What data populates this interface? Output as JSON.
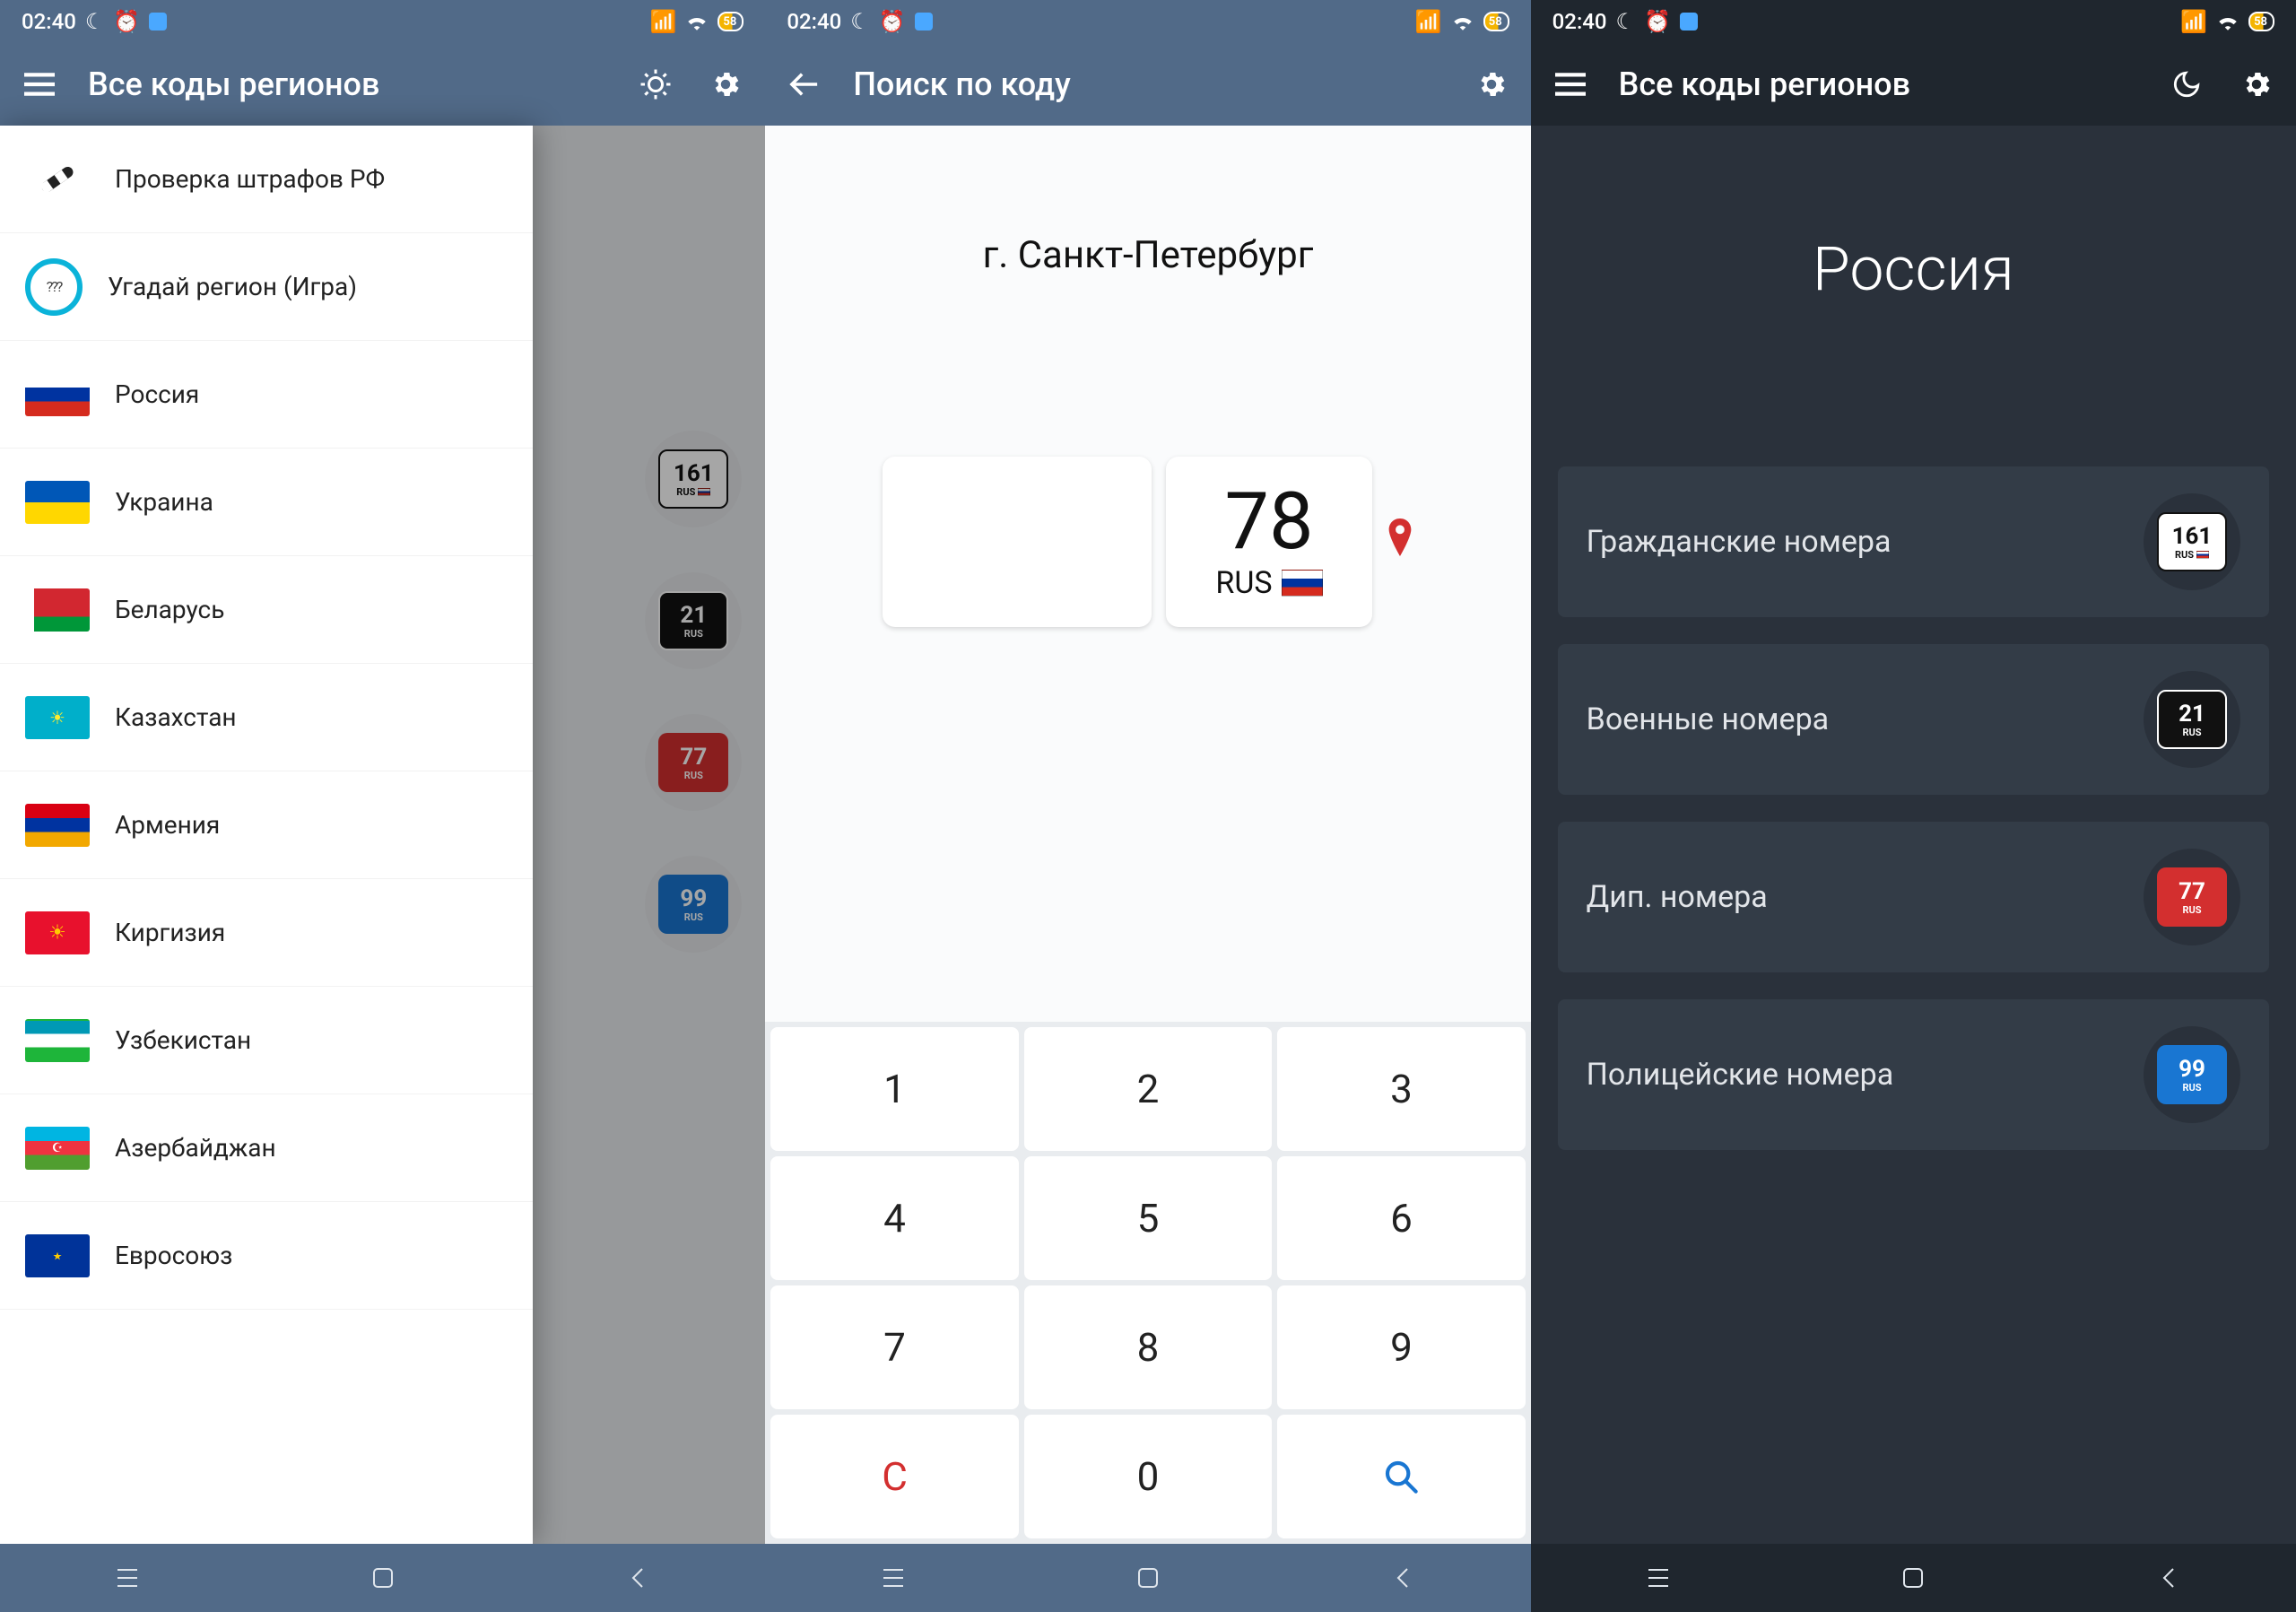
{
  "status": {
    "time": "02:40",
    "battery_label": "58"
  },
  "screen1": {
    "title": "Все коды регионов",
    "drawer": [
      {
        "label": "Проверка штрафов РФ",
        "icon": "police"
      },
      {
        "label": "Угадай регион (Игра)",
        "icon": "game",
        "game_mark": "???"
      },
      {
        "label": "Россия",
        "flag": "ru"
      },
      {
        "label": "Украина",
        "flag": "ua"
      },
      {
        "label": "Беларусь",
        "flag": "by"
      },
      {
        "label": "Казахстан",
        "flag": "kz"
      },
      {
        "label": "Армения",
        "flag": "am"
      },
      {
        "label": "Киргизия",
        "flag": "kg"
      },
      {
        "label": "Узбекистан",
        "flag": "uz"
      },
      {
        "label": "Азербайджан",
        "flag": "az"
      },
      {
        "label": "Евросоюз",
        "flag": "eu"
      }
    ],
    "bg_plates": [
      {
        "num": "161",
        "rus": "RUS",
        "style": "white"
      },
      {
        "num": "21",
        "rus": "RUS",
        "style": "black"
      },
      {
        "num": "77",
        "rus": "RUS",
        "style": "red"
      },
      {
        "num": "99",
        "rus": "RUS",
        "style": "blue"
      }
    ]
  },
  "screen2": {
    "title": "Поиск по коду",
    "result_region": "г. Санкт-Петербург",
    "code": "78",
    "rus": "RUS",
    "keypad": [
      "1",
      "2",
      "3",
      "4",
      "5",
      "6",
      "7",
      "8",
      "9",
      "C",
      "0",
      "search"
    ]
  },
  "screen3": {
    "title": "Все коды регионов",
    "big_title": "Россия",
    "cards": [
      {
        "label": "Гражданские номера",
        "plate_num": "161",
        "plate_rus": "RUS",
        "style": "white"
      },
      {
        "label": "Военные номера",
        "plate_num": "21",
        "plate_rus": "RUS",
        "style": "black"
      },
      {
        "label": "Дип. номера",
        "plate_num": "77",
        "plate_rus": "RUS",
        "style": "red"
      },
      {
        "label": "Полицейские номера",
        "plate_num": "99",
        "plate_rus": "RUS",
        "style": "blue"
      }
    ]
  }
}
